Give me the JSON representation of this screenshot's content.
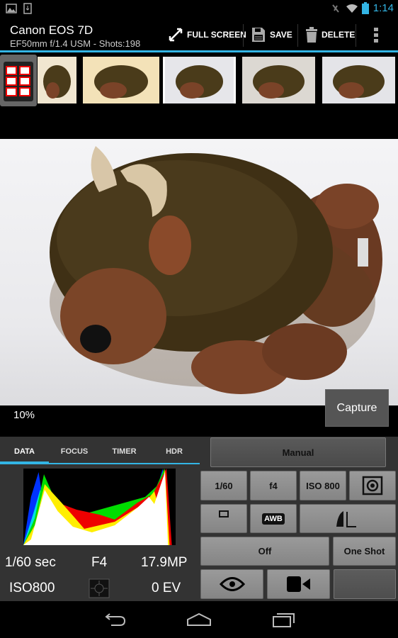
{
  "status": {
    "time": "1:14",
    "icons": [
      "gallery-icon",
      "download-icon",
      "mute-icon",
      "wifi-icon",
      "battery-icon"
    ]
  },
  "header": {
    "title": "Canon EOS 7D",
    "subtitle": "EF50mm f/1.4 USM - Shots:198",
    "full_screen": "FULL SCREEN",
    "save": "SAVE",
    "delete": "DELETE"
  },
  "preview": {
    "zoom": "10%",
    "capture": "Capture"
  },
  "tabs": [
    {
      "label": "DATA",
      "active": true
    },
    {
      "label": "FOCUS"
    },
    {
      "label": "TIMER"
    },
    {
      "label": "HDR"
    }
  ],
  "data": {
    "shutter": "1/60 sec",
    "aperture": "F4",
    "resolution": "17.9MP",
    "iso": "ISO800",
    "ev": "0 EV"
  },
  "controls": {
    "mode": "Manual",
    "shutter": "1/60",
    "aperture": "f4",
    "iso": "ISO 800",
    "wb": "AWB",
    "drive": "Off",
    "af": "One Shot"
  },
  "colors": {
    "accent": "#33b5e5",
    "button": "#8e8e8e"
  }
}
